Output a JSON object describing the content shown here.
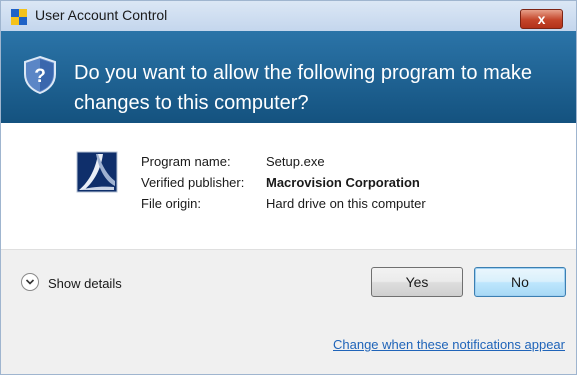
{
  "window": {
    "title": "User Account Control",
    "close_label": "x"
  },
  "prompt": {
    "question": "Do you want to allow the following program to make changes to this computer?"
  },
  "details": {
    "program_name_label": "Program name:",
    "program_name": "Setup.exe",
    "publisher_label": "Verified publisher:",
    "publisher": "Macrovision Corporation",
    "origin_label": "File origin:",
    "origin": "Hard drive on this computer"
  },
  "actions": {
    "show_details": "Show details",
    "yes": "Yes",
    "no": "No"
  },
  "footer": {
    "link": "Change when these notifications appear"
  },
  "icons": {
    "title": "uac-shield-icon",
    "banner": "uac-question-shield-icon",
    "program": "setup-program-icon",
    "expand": "chevron-down-icon"
  },
  "colors": {
    "banner": "#14527f",
    "link": "#1f64b9",
    "close": "#c4452a"
  }
}
